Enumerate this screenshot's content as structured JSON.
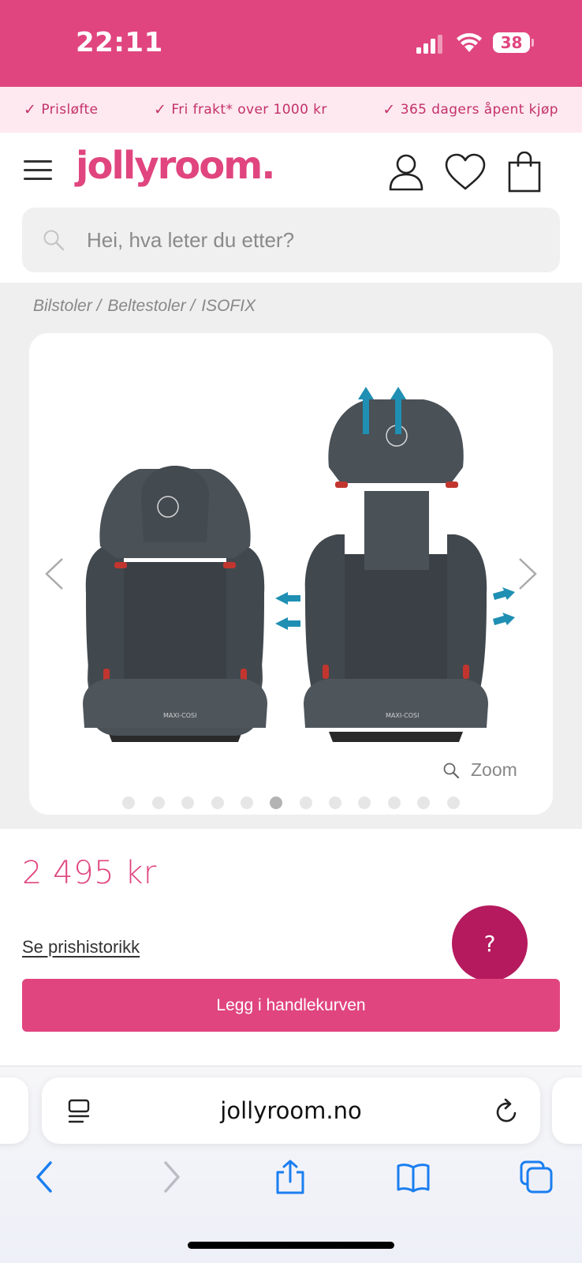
{
  "status_bar": {
    "time": "22:11",
    "battery": "38"
  },
  "usp": [
    {
      "icon": "check-icon",
      "label": "Prisløfte"
    },
    {
      "icon": "check-icon",
      "label": "Fri frakt* over 1000 kr"
    },
    {
      "icon": "check-icon",
      "label": "365 dagers åpent kjøp"
    }
  ],
  "header": {
    "logo": "jollyroom.",
    "icons": [
      "menu-icon",
      "user-icon",
      "heart-icon",
      "bag-icon"
    ]
  },
  "search": {
    "placeholder": "Hei, hva leter du etter?"
  },
  "breadcrumb": [
    "Bilstoler /",
    "Beltestoler /",
    "ISOFIX"
  ],
  "gallery": {
    "zoom_label": "Zoom",
    "dot_count": 12,
    "active_index": 5
  },
  "product": {
    "price": "2 495 kr",
    "price_history": "Se prishistorikk",
    "add_to_cart": "Legg i handlekurven",
    "help": "?"
  },
  "browser": {
    "url": "jollyroom.no"
  },
  "colors": {
    "brand": "#e0457f",
    "help": "#b51a5e",
    "accent_blue": "#1a7ef0"
  }
}
